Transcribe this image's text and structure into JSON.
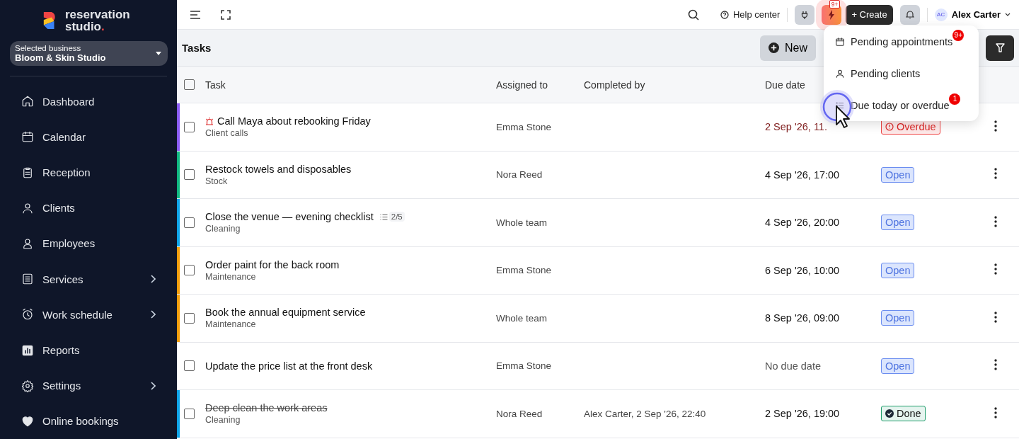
{
  "logo": {
    "line1": "reservation",
    "line2": "studio",
    "dot": "."
  },
  "business": {
    "label": "Selected business",
    "name": "Bloom & Skin Studio"
  },
  "nav": [
    {
      "label": "Dashboard",
      "arrow": false
    },
    {
      "label": "Calendar",
      "arrow": false
    },
    {
      "label": "Reception",
      "arrow": false
    },
    {
      "label": "Clients",
      "arrow": false
    },
    {
      "label": "Employees",
      "arrow": false
    },
    {
      "label": "Services",
      "arrow": true
    },
    {
      "label": "Work schedule",
      "arrow": true
    },
    {
      "label": "Reports",
      "arrow": false
    },
    {
      "label": "Settings",
      "arrow": true
    },
    {
      "label": "Online bookings",
      "arrow": false
    }
  ],
  "topbar": {
    "help": "Help center",
    "alerts_badge": "9+",
    "create": "+ Create",
    "user": {
      "initials": "AC",
      "name": "Alex Carter"
    }
  },
  "page": {
    "title": "Tasks",
    "new_button": "New"
  },
  "select_all": {
    "checked": false
  },
  "columns": [
    "Task",
    "Assigned to",
    "Completed by",
    "Due date"
  ],
  "rows": [
    {
      "checked": false,
      "color": "#8b5cf6",
      "urgent": true,
      "title": "Call Maya about rebooking Friday",
      "category": "Client calls",
      "assigned": "Emma Stone",
      "due": "2 Sep '26, 11.",
      "has_due_date": true,
      "status": {
        "kind": "overdue",
        "label": "Overdue"
      }
    },
    {
      "checked": false,
      "color": "#10b981",
      "urgent": false,
      "title": "Restock towels and disposables",
      "category": "Stock",
      "assigned": "Nora Reed",
      "due": "4 Sep '26, 17:00",
      "has_due_date": true,
      "status": {
        "kind": "open",
        "label": "Open"
      }
    },
    {
      "checked": false,
      "color": "#0ea5e9",
      "urgent": false,
      "title": "Close the venue — evening checklist",
      "subtasks": "2/5",
      "category": "Cleaning",
      "assigned": "Whole team",
      "due": "4 Sep '26, 20:00",
      "has_due_date": true,
      "status": {
        "kind": "open",
        "label": "Open"
      }
    },
    {
      "checked": false,
      "color": "#f59e0b",
      "urgent": false,
      "title": "Order paint for the back room",
      "category": "Maintenance",
      "assigned": "Emma Stone",
      "due": "6 Sep '26, 10:00",
      "has_due_date": true,
      "status": {
        "kind": "open",
        "label": "Open"
      }
    },
    {
      "checked": false,
      "color": "#f59e0b",
      "urgent": false,
      "title": "Book the annual equipment service",
      "category": "Maintenance",
      "assigned": "Whole team",
      "due": "8 Sep '26, 09:00",
      "has_due_date": true,
      "status": {
        "kind": "open",
        "label": "Open"
      }
    },
    {
      "checked": false,
      "urgent": false,
      "title": "Update the price list at the front desk",
      "assigned": "Emma Stone",
      "due": "No due date",
      "has_due_date": false,
      "status": {
        "kind": "open",
        "label": "Open"
      }
    },
    {
      "checked": false,
      "color": "#0ea5e9",
      "urgent": false,
      "title": "Deep clean the work areas",
      "category": "Cleaning",
      "assigned": "Nora Reed",
      "completed_by": "Alex Carter, 2 Sep '26, 22:40",
      "due": "2 Sep '26, 19:00",
      "has_due_date": true,
      "status": {
        "kind": "done",
        "label": "Done"
      }
    }
  ],
  "menu": [
    {
      "label": "Pending appointments",
      "badge": "9+"
    },
    {
      "label": "Pending clients"
    },
    {
      "label": "Due today or overdue",
      "badge": "1"
    }
  ]
}
